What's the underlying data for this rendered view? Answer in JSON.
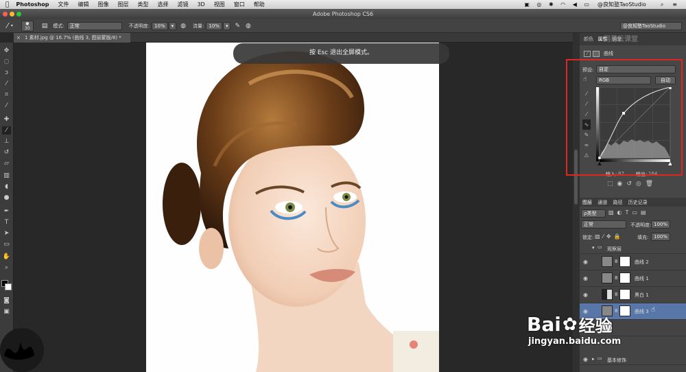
{
  "menubar": {
    "app_name": "Photoshop",
    "items": [
      "文件",
      "编辑",
      "图像",
      "图层",
      "类型",
      "选择",
      "滤镜",
      "3D",
      "视图",
      "窗口",
      "帮助"
    ],
    "user": "@良知塾TaoStudio"
  },
  "window": {
    "title": "Adobe Photoshop CS6"
  },
  "options_bar": {
    "brush_size": "30",
    "mode_label": "模式:",
    "mode_value": "正常",
    "opacity_label": "不透明度:",
    "opacity_value": "10%",
    "flow_label": "流量:",
    "flow_value": "10%",
    "workspace_value": "@良知塾TaoStudio"
  },
  "document": {
    "tab_label": "1 素材.jpg @ 16.7% (曲线 3, 图层蒙版/8) *"
  },
  "esc_banner": {
    "text": "按 Esc 退出全屏模式。"
  },
  "panel_top": {
    "tabs": [
      "颜色",
      "属性",
      "调整"
    ]
  },
  "properties": {
    "title": "曲线",
    "preset_label": "预设:",
    "preset_value": "自定",
    "channel_value": "RGB",
    "auto_button": "自动",
    "input_label": "输入:",
    "input_value": "87",
    "output_label": "输出:",
    "output_value": "164"
  },
  "layers_panel": {
    "tabs": [
      "图层",
      "通道",
      "路径",
      "历史记录"
    ],
    "filter_value": "ρ类型",
    "blend_mode": "正常",
    "opacity_label": "不透明度:",
    "opacity_value": "100%",
    "lock_label": "锁定:",
    "fill_label": "填充:",
    "fill_value": "100%",
    "group_name": "观察层",
    "layers": [
      {
        "name": "曲线 2"
      },
      {
        "name": "曲线 1"
      },
      {
        "name": "黑白 1"
      },
      {
        "name": "曲线 3"
      }
    ],
    "bottom_group": "基本修饰"
  },
  "watermark": {
    "brand": "Bai",
    "brand_cn": "经验",
    "url": "jingyan.baidu.com",
    "top_right": "网易云课堂"
  },
  "colors": {
    "highlight": "#e0261e",
    "bg": "#282828",
    "panel": "#474747"
  }
}
